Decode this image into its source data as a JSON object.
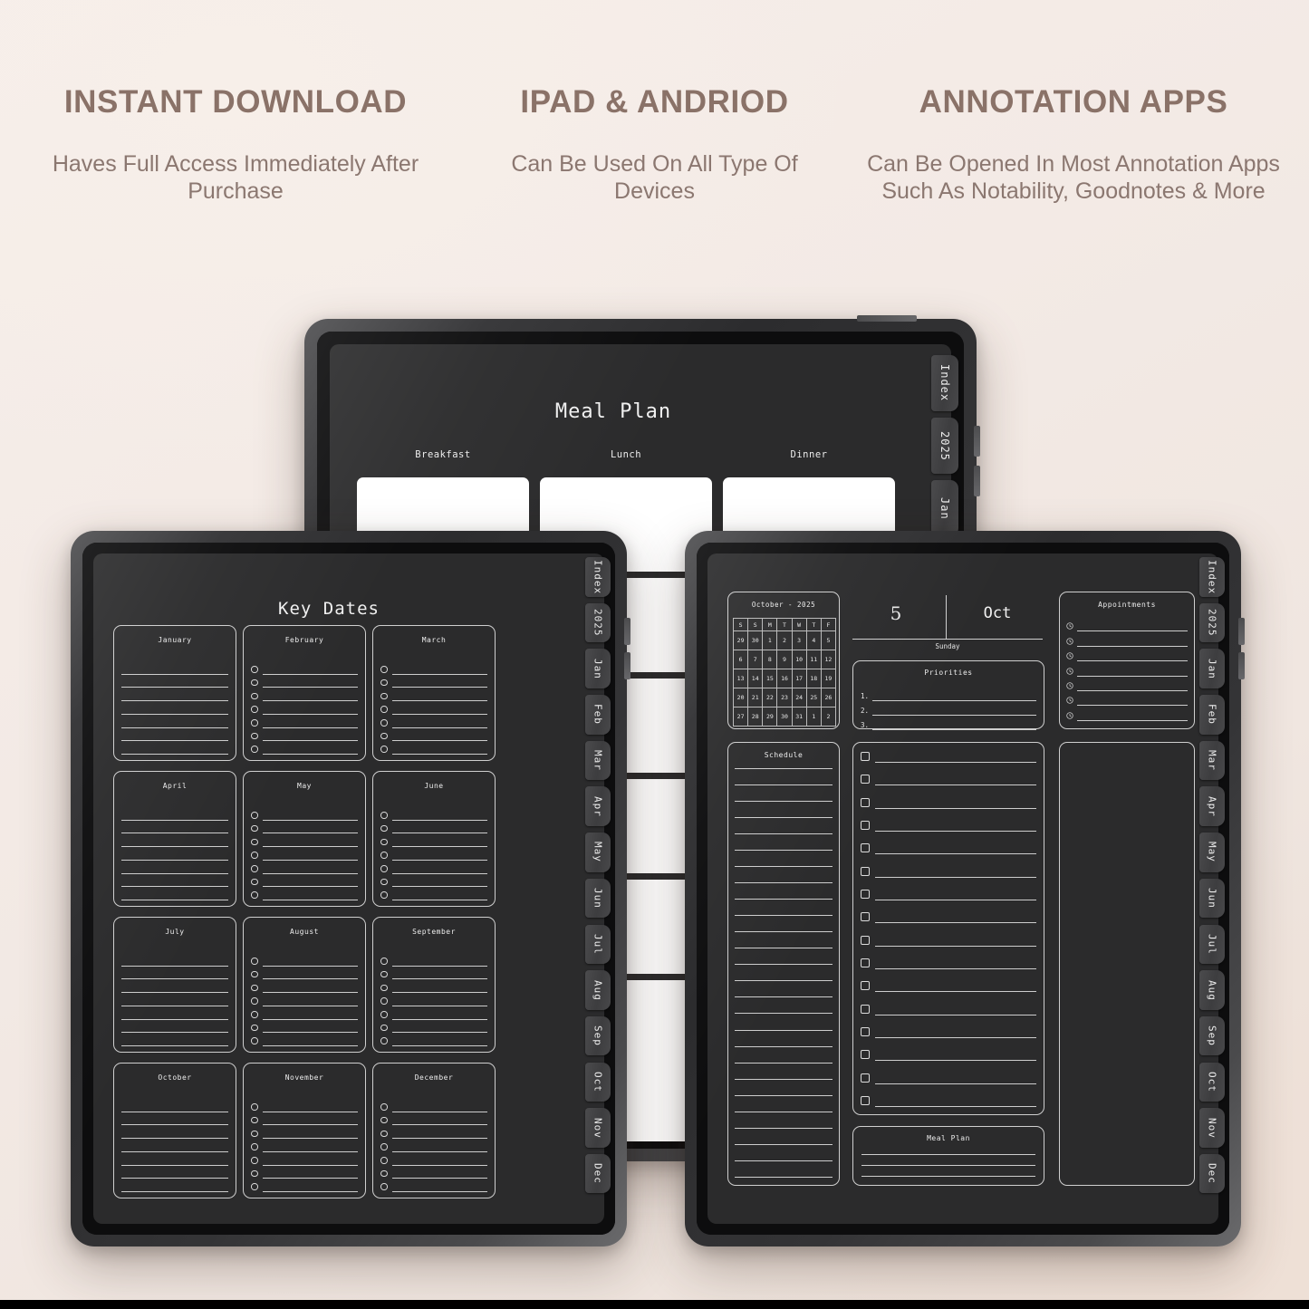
{
  "promo": {
    "columns": [
      {
        "title": "INSTANT DOWNLOAD",
        "subtitle": "Haves Full Access Immediately After Purchase"
      },
      {
        "title": "IPAD & ANDRIOD",
        "subtitle": "Can Be Used On All Type Of Devices"
      },
      {
        "title": "ANNOTATION APPS",
        "subtitle": "Can Be Opened In Most Annotation Apps Such As Notability, Goodnotes & More"
      }
    ],
    "colors": {
      "title": "#8a7268",
      "subtitle": "#8b7770",
      "background": "#f3eae5"
    }
  },
  "tabs": [
    "Index",
    "2025",
    "Jan",
    "Feb",
    "Mar",
    "Apr",
    "May",
    "Jun",
    "Jul",
    "Aug",
    "Sep",
    "Oct",
    "Nov",
    "Dec"
  ],
  "back_tablet": {
    "page_title": "Meal Plan",
    "meal_columns": [
      "Breakfast",
      "Lunch",
      "Dinner"
    ],
    "tabs_visible": [
      "Index",
      "2025",
      "Jan"
    ]
  },
  "left_tablet": {
    "page_title": "Key Dates",
    "months": [
      {
        "name": "January",
        "style": "lines",
        "rows": 7
      },
      {
        "name": "February",
        "style": "bullets",
        "rows": 7
      },
      {
        "name": "March",
        "style": "bullets",
        "rows": 7
      },
      {
        "name": "April",
        "style": "lines",
        "rows": 7
      },
      {
        "name": "May",
        "style": "bullets",
        "rows": 7
      },
      {
        "name": "June",
        "style": "bullets",
        "rows": 7
      },
      {
        "name": "July",
        "style": "lines",
        "rows": 7
      },
      {
        "name": "August",
        "style": "bullets",
        "rows": 7
      },
      {
        "name": "September",
        "style": "bullets",
        "rows": 7
      },
      {
        "name": "October",
        "style": "lines",
        "rows": 7
      },
      {
        "name": "November",
        "style": "bullets",
        "rows": 7
      },
      {
        "name": "December",
        "style": "bullets",
        "rows": 7
      }
    ]
  },
  "right_tablet": {
    "mini_calendar": {
      "title": "October - 2025",
      "weekday_headers": [
        "S",
        "S",
        "M",
        "T",
        "W",
        "T",
        "F"
      ],
      "weeks": [
        [
          "29",
          "30",
          "1",
          "2",
          "3",
          "4",
          "5"
        ],
        [
          "6",
          "7",
          "8",
          "9",
          "10",
          "11",
          "12"
        ],
        [
          "13",
          "14",
          "15",
          "16",
          "17",
          "18",
          "19"
        ],
        [
          "20",
          "21",
          "22",
          "23",
          "24",
          "25",
          "26"
        ],
        [
          "27",
          "28",
          "29",
          "30",
          "31",
          "1",
          "2"
        ]
      ]
    },
    "date_header": {
      "day_number": "5",
      "month": "Oct",
      "weekday": "Sunday"
    },
    "priorities": {
      "title": "Priorities",
      "items": [
        "1.",
        "2.",
        "3."
      ]
    },
    "appointments": {
      "title": "Appointments",
      "rows": 7,
      "icon": "clock-icon"
    },
    "schedule": {
      "title": "Schedule",
      "rows": 26
    },
    "tasks": {
      "rows": 16,
      "icon": "checkbox-icon"
    },
    "meal_plan": {
      "title": "Meal Plan",
      "rows": 3
    },
    "notes": {
      "rows": 0
    }
  }
}
